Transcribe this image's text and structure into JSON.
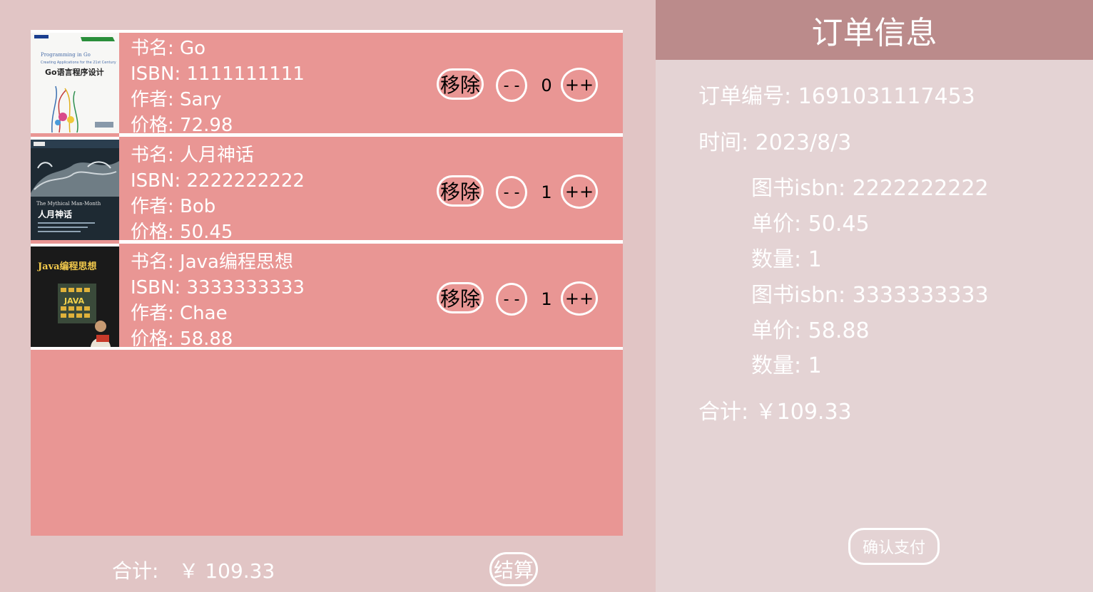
{
  "cart": {
    "items": [
      {
        "title_label": "书名: Go",
        "isbn_label": "ISBN: 1111111111",
        "author_label": "作者: Sary",
        "price_label": "价格: 72.98",
        "cover_text": "Go语言程序设计",
        "remove_label": "移除",
        "minus_label": "- -",
        "quantity": "0",
        "plus_label": "++"
      },
      {
        "title_label": "书名: 人月神话",
        "isbn_label": "ISBN: 2222222222",
        "author_label": "作者: Bob",
        "price_label": "价格: 50.45",
        "cover_text": "人月神话",
        "remove_label": "移除",
        "minus_label": "- -",
        "quantity": "1",
        "plus_label": "++"
      },
      {
        "title_label": "书名: Java编程思想",
        "isbn_label": "ISBN: 3333333333",
        "author_label": "作者: Chae",
        "price_label": "价格: 58.88",
        "cover_text": "Java编程思想",
        "remove_label": "移除",
        "minus_label": "- -",
        "quantity": "1",
        "plus_label": "++"
      }
    ],
    "total_label": "合计:",
    "total_value": "￥ 109.33",
    "checkout_label": "结算"
  },
  "order": {
    "title": "订单信息",
    "order_id_label": "订单编号: 1691031117453",
    "time_label": "时间: 2023/8/3",
    "lines": [
      {
        "isbn_label": "图书isbn: 2222222222",
        "price_label": "单价: 50.45",
        "qty_label": "数量: 1"
      },
      {
        "isbn_label": "图书isbn: 3333333333",
        "price_label": "单价: 58.88",
        "qty_label": "数量: 1"
      }
    ],
    "total_label": "合计: ￥109.33",
    "confirm_label": "确认支付"
  },
  "colors": {
    "page_bg": "#e1c5c5",
    "cart_bg": "#e99694",
    "order_panel_bg": "#e4d3d4",
    "order_header_bg": "#bb8b8b"
  }
}
